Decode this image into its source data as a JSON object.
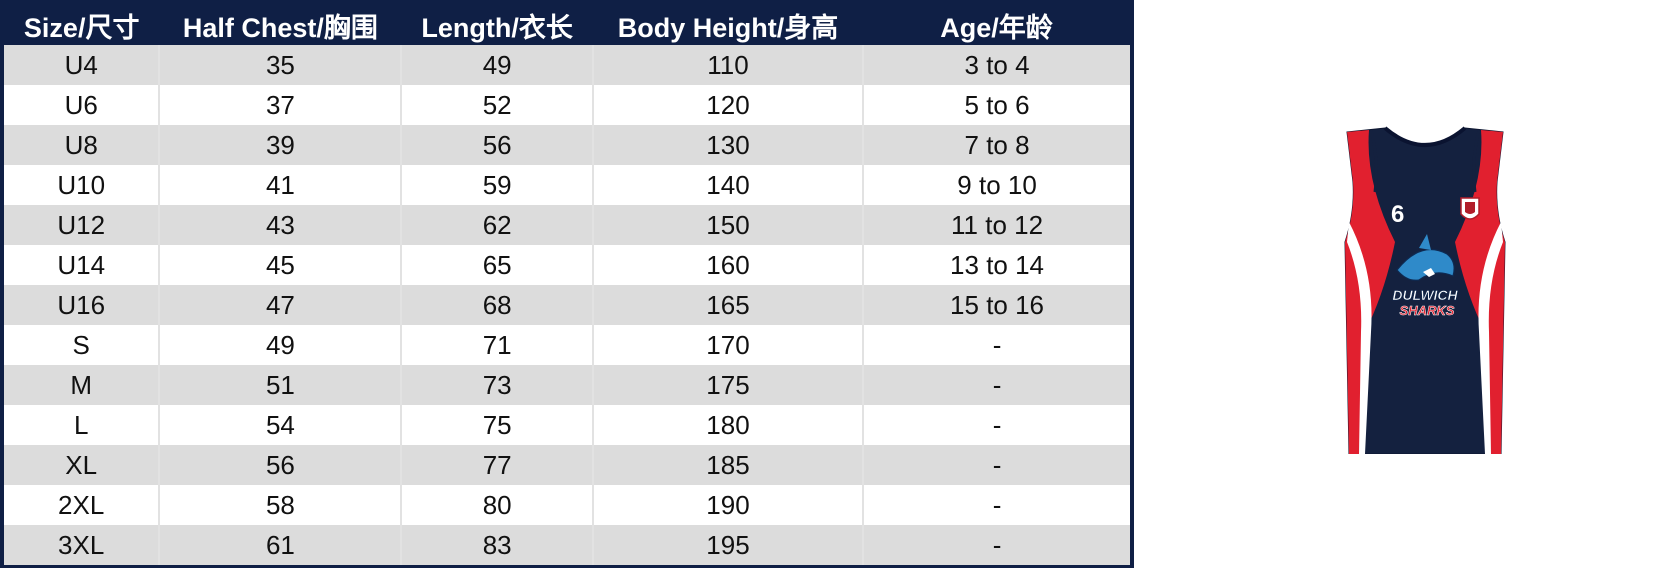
{
  "table": {
    "headers": [
      "Size/尺寸",
      "Half Chest/胸围",
      "Length/衣长",
      "Body Height/身高",
      "Age/年龄"
    ],
    "rows": [
      [
        "U4",
        "35",
        "49",
        "110",
        "3 to 4"
      ],
      [
        "U6",
        "37",
        "52",
        "120",
        "5 to 6"
      ],
      [
        "U8",
        "39",
        "56",
        "130",
        "7 to 8"
      ],
      [
        "U10",
        "41",
        "59",
        "140",
        "9 to 10"
      ],
      [
        "U12",
        "43",
        "62",
        "150",
        "11 to 12"
      ],
      [
        "U14",
        "45",
        "65",
        "160",
        "13 to 14"
      ],
      [
        "U16",
        "47",
        "68",
        "165",
        "15 to 16"
      ],
      [
        "S",
        "49",
        "71",
        "170",
        "-"
      ],
      [
        "M",
        "51",
        "73",
        "175",
        "-"
      ],
      [
        "L",
        "54",
        "75",
        "180",
        "-"
      ],
      [
        "XL",
        "56",
        "77",
        "185",
        "-"
      ],
      [
        "2XL",
        "58",
        "80",
        "190",
        "-"
      ],
      [
        "3XL",
        "61",
        "83",
        "195",
        "-"
      ]
    ]
  },
  "jersey": {
    "number": "6",
    "logo_text_line1": "DULWICH",
    "logo_text_line2": "SHARKS",
    "colors": {
      "navy": "#14213f",
      "red": "#e1202f",
      "white": "#ffffff"
    }
  },
  "colors": {
    "header_bg": "#0f1f45",
    "row_shade": "#dcdcdc",
    "row_plain": "#ffffff"
  }
}
